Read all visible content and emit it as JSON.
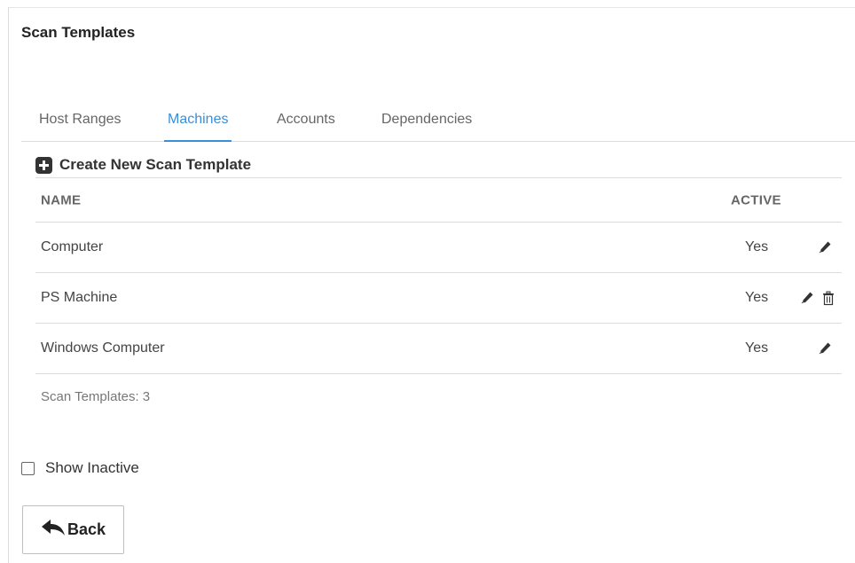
{
  "page": {
    "title": "Scan Templates"
  },
  "tabs": [
    {
      "label": "Host Ranges",
      "active": false
    },
    {
      "label": "Machines",
      "active": true
    },
    {
      "label": "Accounts",
      "active": false
    },
    {
      "label": "Dependencies",
      "active": false
    }
  ],
  "create": {
    "label": "Create New Scan Template",
    "icon": "plus-square-icon"
  },
  "table": {
    "headers": {
      "name": "NAME",
      "active": "ACTIVE"
    },
    "rows": [
      {
        "name": "Computer",
        "active": "Yes",
        "actions": [
          "edit"
        ]
      },
      {
        "name": "PS Machine",
        "active": "Yes",
        "actions": [
          "edit",
          "delete"
        ]
      },
      {
        "name": "Windows Computer",
        "active": "Yes",
        "actions": [
          "edit"
        ]
      }
    ]
  },
  "footer": {
    "count_label": "Scan Templates: 3"
  },
  "show_inactive": {
    "label": "Show Inactive",
    "checked": false
  },
  "back": {
    "label": "Back",
    "icon": "reply-arrow-icon"
  },
  "colors": {
    "accent": "#3b8ed8",
    "text": "#333333",
    "border": "#dcdcdc"
  }
}
